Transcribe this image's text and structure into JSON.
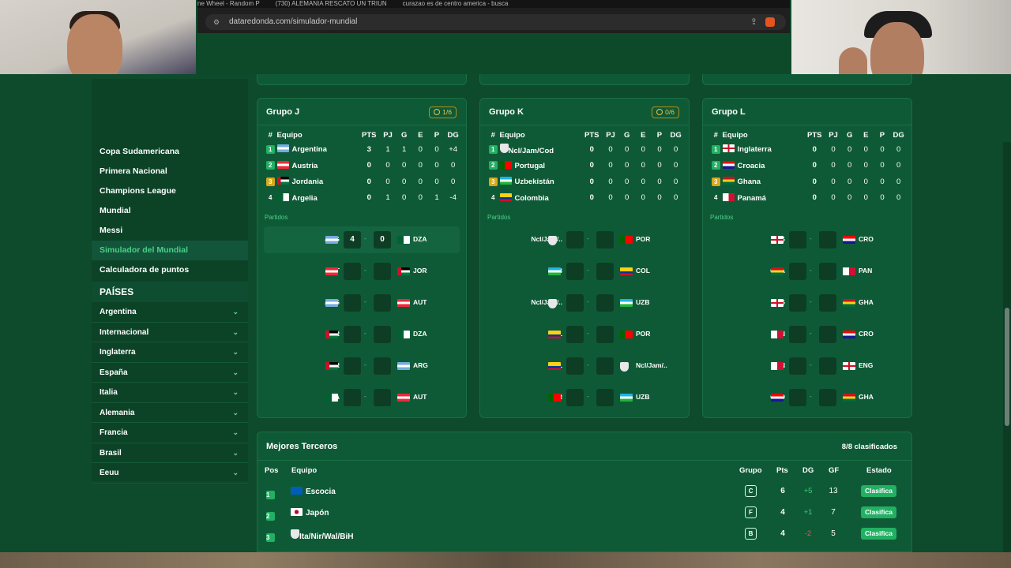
{
  "browser": {
    "tabs": [
      "ne Wheel - Random P",
      "(730) ALEMANIA RESCATO UN TRIUN",
      "curazao es de centro america - busca"
    ],
    "url": "dataredonda.com/simulador-mundial"
  },
  "sidebar": {
    "items": [
      {
        "label": "Copa Sudamericana",
        "active": false
      },
      {
        "label": "Primera Nacional",
        "active": false
      },
      {
        "label": "Champions League",
        "active": false
      },
      {
        "label": "Mundial",
        "active": false
      },
      {
        "label": "Messi",
        "active": false
      },
      {
        "label": "Simulador del Mundial",
        "active": true
      },
      {
        "label": "Calculadora de puntos",
        "active": false
      }
    ],
    "countries_title": "PAÍSES",
    "countries": [
      "Argentina",
      "Internacional",
      "Inglaterra",
      "España",
      "Italia",
      "Alemania",
      "Francia",
      "Brasil",
      "Eeuu"
    ]
  },
  "headers": {
    "pos": "#",
    "team": "Equipo",
    "pts": "PTS",
    "pj": "PJ",
    "g": "G",
    "e": "E",
    "p": "P",
    "dg": "DG",
    "partidos": "Partidos",
    "dash": "-"
  },
  "groups": [
    {
      "title": "Grupo J",
      "badge": "1/6",
      "standings": [
        {
          "pos": "1",
          "team": "Argentina",
          "flag": "arg",
          "pts": "3",
          "pj": "1",
          "g": "1",
          "e": "0",
          "p": "0",
          "dg": "+4"
        },
        {
          "pos": "2",
          "team": "Austria",
          "flag": "aut",
          "pts": "0",
          "pj": "0",
          "g": "0",
          "e": "0",
          "p": "0",
          "dg": "0"
        },
        {
          "pos": "3",
          "team": "Jordania",
          "flag": "jor",
          "pts": "0",
          "pj": "0",
          "g": "0",
          "e": "0",
          "p": "0",
          "dg": "0"
        },
        {
          "pos": "4",
          "team": "Argelia",
          "flag": "dza",
          "pts": "0",
          "pj": "1",
          "g": "0",
          "e": "0",
          "p": "1",
          "dg": "-4"
        }
      ],
      "matches": [
        {
          "home": "ARG",
          "hflag": "arg",
          "hs": "4",
          "as": "0",
          "away": "DZA",
          "aflag": "dza",
          "played": true
        },
        {
          "home": "AUT",
          "hflag": "aut",
          "hs": "",
          "as": "",
          "away": "JOR",
          "aflag": "jor",
          "played": false
        },
        {
          "home": "ARG",
          "hflag": "arg",
          "hs": "",
          "as": "",
          "away": "AUT",
          "aflag": "aut",
          "played": false
        },
        {
          "home": "JOR",
          "hflag": "jor",
          "hs": "",
          "as": "",
          "away": "DZA",
          "aflag": "dza",
          "played": false
        },
        {
          "home": "JOR",
          "hflag": "jor",
          "hs": "",
          "as": "",
          "away": "ARG",
          "aflag": "arg",
          "played": false
        },
        {
          "home": "DZA",
          "hflag": "dza",
          "hs": "",
          "as": "",
          "away": "AUT",
          "aflag": "aut",
          "played": false
        }
      ]
    },
    {
      "title": "Grupo K",
      "badge": "0/6",
      "standings": [
        {
          "pos": "1",
          "team": "Ncl/Jam/Cod",
          "flag": "shield",
          "pts": "0",
          "pj": "0",
          "g": "0",
          "e": "0",
          "p": "0",
          "dg": "0"
        },
        {
          "pos": "2",
          "team": "Portugal",
          "flag": "por",
          "pts": "0",
          "pj": "0",
          "g": "0",
          "e": "0",
          "p": "0",
          "dg": "0"
        },
        {
          "pos": "3",
          "team": "Uzbekistán",
          "flag": "uzb",
          "pts": "0",
          "pj": "0",
          "g": "0",
          "e": "0",
          "p": "0",
          "dg": "0"
        },
        {
          "pos": "4",
          "team": "Colombia",
          "flag": "col",
          "pts": "0",
          "pj": "0",
          "g": "0",
          "e": "0",
          "p": "0",
          "dg": "0"
        }
      ],
      "matches": [
        {
          "home": "Ncl/Jam/..",
          "hflag": "shield",
          "hs": "",
          "as": "",
          "away": "POR",
          "aflag": "por",
          "played": false
        },
        {
          "home": "UZB",
          "hflag": "uzb",
          "hs": "",
          "as": "",
          "away": "COL",
          "aflag": "col",
          "played": false
        },
        {
          "home": "Ncl/Jam/..",
          "hflag": "shield",
          "hs": "",
          "as": "",
          "away": "UZB",
          "aflag": "uzb",
          "played": false
        },
        {
          "home": "COL",
          "hflag": "col",
          "hs": "",
          "as": "",
          "away": "POR",
          "aflag": "por",
          "played": false
        },
        {
          "home": "COL",
          "hflag": "col",
          "hs": "",
          "as": "",
          "away": "Ncl/Jam/..",
          "aflag": "shield",
          "played": false
        },
        {
          "home": "POR",
          "hflag": "por",
          "hs": "",
          "as": "",
          "away": "UZB",
          "aflag": "uzb",
          "played": false
        }
      ]
    },
    {
      "title": "Grupo L",
      "badge": "",
      "standings": [
        {
          "pos": "1",
          "team": "Inglaterra",
          "flag": "eng",
          "pts": "0",
          "pj": "0",
          "g": "0",
          "e": "0",
          "p": "0",
          "dg": "0"
        },
        {
          "pos": "2",
          "team": "Croacia",
          "flag": "cro",
          "pts": "0",
          "pj": "0",
          "g": "0",
          "e": "0",
          "p": "0",
          "dg": "0"
        },
        {
          "pos": "3",
          "team": "Ghana",
          "flag": "gha",
          "pts": "0",
          "pj": "0",
          "g": "0",
          "e": "0",
          "p": "0",
          "dg": "0"
        },
        {
          "pos": "4",
          "team": "Panamá",
          "flag": "pan",
          "pts": "0",
          "pj": "0",
          "g": "0",
          "e": "0",
          "p": "0",
          "dg": "0"
        }
      ],
      "matches": [
        {
          "home": "ENG",
          "hflag": "eng",
          "hs": "",
          "as": "",
          "away": "CRO",
          "aflag": "cro",
          "played": false
        },
        {
          "home": "GHA",
          "hflag": "gha",
          "hs": "",
          "as": "",
          "away": "PAN",
          "aflag": "pan",
          "played": false
        },
        {
          "home": "ENG",
          "hflag": "eng",
          "hs": "",
          "as": "",
          "away": "GHA",
          "aflag": "gha",
          "played": false
        },
        {
          "home": "PAN",
          "hflag": "pan",
          "hs": "",
          "as": "",
          "away": "CRO",
          "aflag": "cro",
          "played": false
        },
        {
          "home": "PAN",
          "hflag": "pan",
          "hs": "",
          "as": "",
          "away": "ENG",
          "aflag": "eng",
          "played": false
        },
        {
          "home": "CRO",
          "hflag": "cro",
          "hs": "",
          "as": "",
          "away": "GHA",
          "aflag": "gha",
          "played": false
        }
      ]
    }
  ],
  "terceros": {
    "title": "Mejores Terceros",
    "count": "8/8 clasificados",
    "headers": {
      "pos": "Pos",
      "team": "Equipo",
      "grupo": "Grupo",
      "pts": "Pts",
      "dg": "DG",
      "gf": "GF",
      "estado": "Estado"
    },
    "rows": [
      {
        "pos": "1",
        "team": "Escocia",
        "flag": "sco",
        "grupo": "C",
        "pts": "6",
        "dg": "+5",
        "gf": "13",
        "estado": "Clasifica"
      },
      {
        "pos": "2",
        "team": "Japón",
        "flag": "jpn",
        "grupo": "F",
        "pts": "4",
        "dg": "+1",
        "gf": "7",
        "estado": "Clasifica"
      },
      {
        "pos": "3",
        "team": "Ita/Nir/Wal/BiH",
        "flag": "shield",
        "grupo": "B",
        "pts": "4",
        "dg": "-2",
        "gf": "5",
        "estado": "Clasifica"
      }
    ]
  },
  "colors": {
    "accent": "#22b063",
    "third_place": "#d7a81c",
    "page_bg": "#0e4a2c",
    "card_bg": "#0f5a36"
  }
}
